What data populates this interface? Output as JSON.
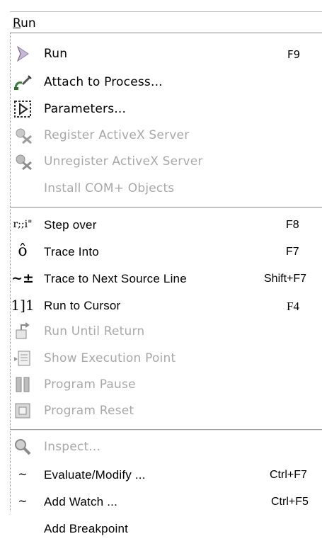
{
  "menu": {
    "title_prefix": "R",
    "title_rest": "un"
  },
  "items_top": [
    {
      "label": "Run",
      "shortcut": "F9",
      "icon": "run-arrow-icon",
      "enabled": true
    },
    {
      "label": "Attach to Process...",
      "shortcut": "",
      "icon": "attach-process-icon",
      "enabled": true
    },
    {
      "label": "Parameters...",
      "shortcut": "",
      "icon": "parameters-icon",
      "enabled": true
    },
    {
      "label": "Register ActiveX Server",
      "shortcut": "",
      "icon": "register-activex-icon",
      "enabled": false
    },
    {
      "label": "Unregister ActiveX Server",
      "shortcut": "",
      "icon": "unregister-activex-icon",
      "enabled": false
    },
    {
      "label": "Install COM+ Objects",
      "shortcut": "",
      "icon": "",
      "enabled": false
    }
  ],
  "items_debug": [
    {
      "label": "Step over",
      "shortcut": "F8",
      "icon": "step-over-icon",
      "glyph": "r;;i\"",
      "enabled": true
    },
    {
      "label": "Trace Into",
      "shortcut": "F7",
      "icon": "trace-into-icon",
      "glyph": "ô",
      "enabled": true
    },
    {
      "label": "Trace to Next Source Line",
      "shortcut": "Shift+F7",
      "icon": "trace-next-line-icon",
      "glyph": "~±",
      "enabled": true
    },
    {
      "label": "Run to Cursor",
      "shortcut": "F4",
      "icon": "run-to-cursor-icon",
      "glyph": "1]1",
      "enabled": true
    },
    {
      "label": "Run Until Return",
      "shortcut": "",
      "icon": "run-until-return-icon",
      "enabled": false
    },
    {
      "label": "Show Execution Point",
      "shortcut": "",
      "icon": "show-execution-point-icon",
      "enabled": false
    },
    {
      "label": "Program Pause",
      "shortcut": "",
      "icon": "program-pause-icon",
      "enabled": false
    },
    {
      "label": "Program Reset",
      "shortcut": "",
      "icon": "program-reset-icon",
      "enabled": false
    }
  ],
  "items_inspect": [
    {
      "label": "Inspect...",
      "shortcut": "",
      "icon": "inspect-icon",
      "enabled": false
    },
    {
      "label": "Evaluate/Modify ...",
      "shortcut": "Ctrl+F7",
      "icon": "evaluate-icon",
      "glyph": "~",
      "enabled": true
    },
    {
      "label": "Add Watch ...",
      "shortcut": "Ctrl+F5",
      "icon": "add-watch-icon",
      "glyph": "~",
      "enabled": true
    },
    {
      "label": "Add Breakpoint",
      "shortcut": "",
      "icon": "",
      "enabled": true
    }
  ],
  "colors": {
    "disabled_text": "#a8a8a8",
    "enabled_text": "#000000",
    "run_arrow": "#b9a7c9"
  }
}
